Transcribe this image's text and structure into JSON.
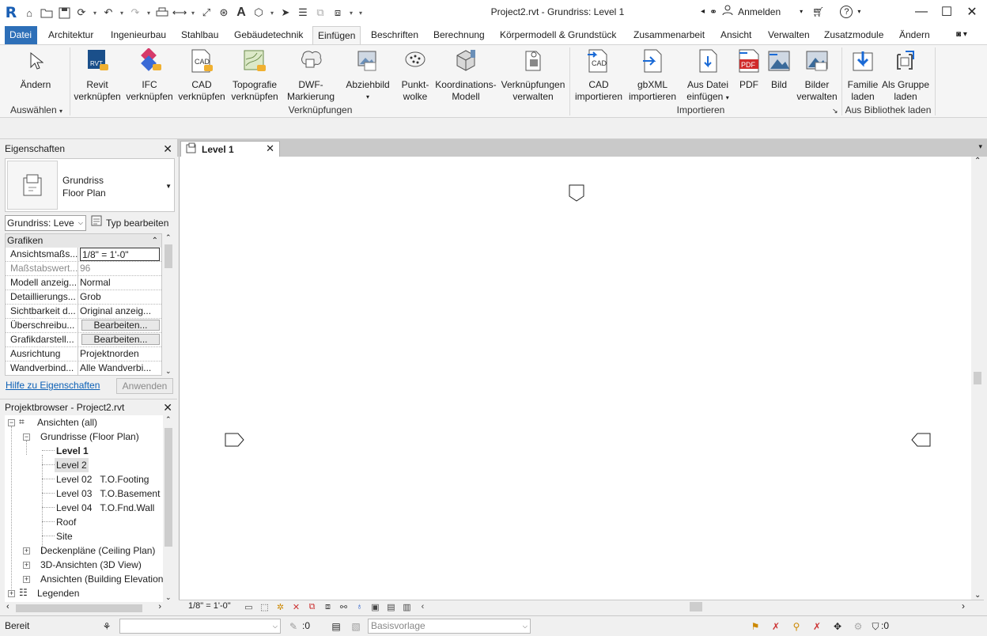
{
  "titlebar": {
    "app_logo": "R",
    "title": "Project2.rvt - Grundriss: Level 1",
    "signin_label": "Anmelden",
    "help_label": "?"
  },
  "menu": {
    "file": "Datei",
    "tabs": [
      "Architektur",
      "Ingenieurbau",
      "Stahlbau",
      "Gebäudetechnik",
      "Einfügen",
      "Beschriften",
      "Berechnung",
      "Körpermodell & Grundstück",
      "Zusammenarbeit",
      "Ansicht",
      "Verwalten",
      "Zusatzmodule",
      "Ändern"
    ],
    "active": "Einfügen"
  },
  "ribbon": {
    "select": {
      "label": "Ändern",
      "panel": "Auswählen"
    },
    "links_panel": "Verknüpfungen",
    "links": [
      {
        "l1": "Revit",
        "l2": "verknüpfen",
        "icon": "rvt-link-icon"
      },
      {
        "l1": "IFC",
        "l2": "verknüpfen",
        "icon": "ifc-link-icon"
      },
      {
        "l1": "CAD",
        "l2": "verknüpfen",
        "icon": "cad-link-icon"
      },
      {
        "l1": "Topografie",
        "l2": "verknüpfen",
        "icon": "topo-link-icon"
      },
      {
        "l1": "DWF-",
        "l2": "Markierung",
        "icon": "dwf-markup-icon"
      },
      {
        "l1": "Abziehbild",
        "l2": "",
        "icon": "decal-icon"
      },
      {
        "l1": "Punkt-",
        "l2": "wolke",
        "icon": "point-cloud-icon"
      },
      {
        "l1": "Koordinations-",
        "l2": "Modell",
        "icon": "coordination-model-icon"
      },
      {
        "l1": "Verknüpfungen",
        "l2": "verwalten",
        "icon": "manage-links-icon"
      }
    ],
    "import_panel": "Importieren",
    "imports": [
      {
        "l1": "CAD",
        "l2": "importieren",
        "icon": "cad-import-icon"
      },
      {
        "l1": "gbXML",
        "l2": "importieren",
        "icon": "gbxml-import-icon"
      },
      {
        "l1": "Aus Datei",
        "l2": "einfügen",
        "icon": "insert-from-file-icon"
      },
      {
        "l1": "PDF",
        "l2": "",
        "icon": "pdf-icon"
      },
      {
        "l1": "Bild",
        "l2": "",
        "icon": "image-icon"
      },
      {
        "l1": "Bilder",
        "l2": "verwalten",
        "icon": "manage-images-icon"
      }
    ],
    "library_panel": "Aus Bibliothek laden",
    "library": [
      {
        "l1": "Familie",
        "l2": "laden",
        "icon": "load-family-icon"
      },
      {
        "l1": "Als Gruppe",
        "l2": "laden",
        "icon": "load-as-group-icon"
      }
    ],
    "icon_text": {
      "cad": "CAD",
      "pdf": "PDF",
      "rvt": "RVT"
    }
  },
  "properties": {
    "title": "Eigenschaften",
    "type_line1": "Grundriss",
    "type_line2": "Floor Plan",
    "instance_filter": "Grundriss: Leve",
    "edit_type": "Typ bearbeiten",
    "group": "Grafiken",
    "rows": [
      {
        "k": "Ansichtsmaßs...",
        "v": "1/8\" = 1'-0\""
      },
      {
        "k": "Maßstabswert...",
        "v": "96"
      },
      {
        "k": "Modell anzeig...",
        "v": "Normal"
      },
      {
        "k": "Detaillierungs...",
        "v": "Grob"
      },
      {
        "k": "Sichtbarkeit d...",
        "v": "Original anzeig..."
      },
      {
        "k": "Überschreibu...",
        "v": "Bearbeiten..."
      },
      {
        "k": "Grafikdarstell...",
        "v": "Bearbeiten..."
      },
      {
        "k": "Ausrichtung",
        "v": "Projektnorden"
      },
      {
        "k": "Wandverbind...",
        "v": "Alle Wandverbi..."
      }
    ],
    "help_link": "Hilfe zu Eigenschaften",
    "apply": "Anwenden"
  },
  "browser": {
    "title": "Projektbrowser - Project2.rvt",
    "root": "Ansichten (all)",
    "floorplans": "Grundrisse (Floor Plan)",
    "levels": [
      {
        "name": "Level 1",
        "extra": ""
      },
      {
        "name": "Level 2",
        "extra": ""
      },
      {
        "name": "Level 02",
        "extra": "T.O.Footing"
      },
      {
        "name": "Level 03",
        "extra": "T.O.Basement"
      },
      {
        "name": "Level 04",
        "extra": "T.O.Fnd.Wall"
      },
      {
        "name": "Roof",
        "extra": ""
      },
      {
        "name": "Site",
        "extra": ""
      }
    ],
    "ceiling": "Deckenpläne (Ceiling Plan)",
    "view3d": "3D-Ansichten (3D View)",
    "elevations": "Ansichten (Building Elevation",
    "legends": "Legenden"
  },
  "view": {
    "tab": "Level 1",
    "scale": "1/8\" = 1'-0\""
  },
  "status": {
    "text": "Bereit",
    "select_count": ":0",
    "view_template": "Basisvorlage",
    "filter_count": ":0"
  },
  "colors": {
    "file_tab": "#2d6fb8",
    "link_text": "#0b5fb5",
    "revit_blue": "#1a5fb4"
  }
}
